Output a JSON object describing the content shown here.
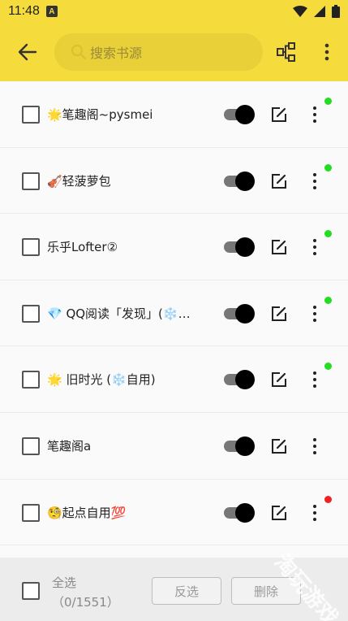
{
  "status_bar": {
    "time": "11:48",
    "notification_icon": "A"
  },
  "toolbar": {
    "back_icon": "arrow-left-icon",
    "search_placeholder": "搜索书源",
    "group_icon": "tree-icon",
    "menu_icon": "more-vert-icon"
  },
  "sources": [
    {
      "name": "🌟笔趣阁~pysmei",
      "enabled": true,
      "status_color": "#22dd22"
    },
    {
      "name": "🎻轻菠萝包",
      "enabled": true,
      "status_color": "#22dd22"
    },
    {
      "name": "乐乎Lofter②",
      "enabled": true,
      "status_color": "#22dd22"
    },
    {
      "name": "💎 QQ阅读「发现」(❄️…",
      "enabled": true,
      "status_color": "#22dd22"
    },
    {
      "name": "🌟 旧时光 (❄️自用)",
      "enabled": true,
      "status_color": "#22dd22"
    },
    {
      "name": "笔趣阁a",
      "enabled": true,
      "status_color": ""
    },
    {
      "name": "🧐起点自用💯",
      "enabled": true,
      "status_color": "#ee2222"
    }
  ],
  "bottom_bar": {
    "select_all_label": "全选",
    "selection_count": "（0/1551）",
    "invert_label": "反选",
    "delete_label": "删除"
  },
  "watermark": "淘玩游戏"
}
